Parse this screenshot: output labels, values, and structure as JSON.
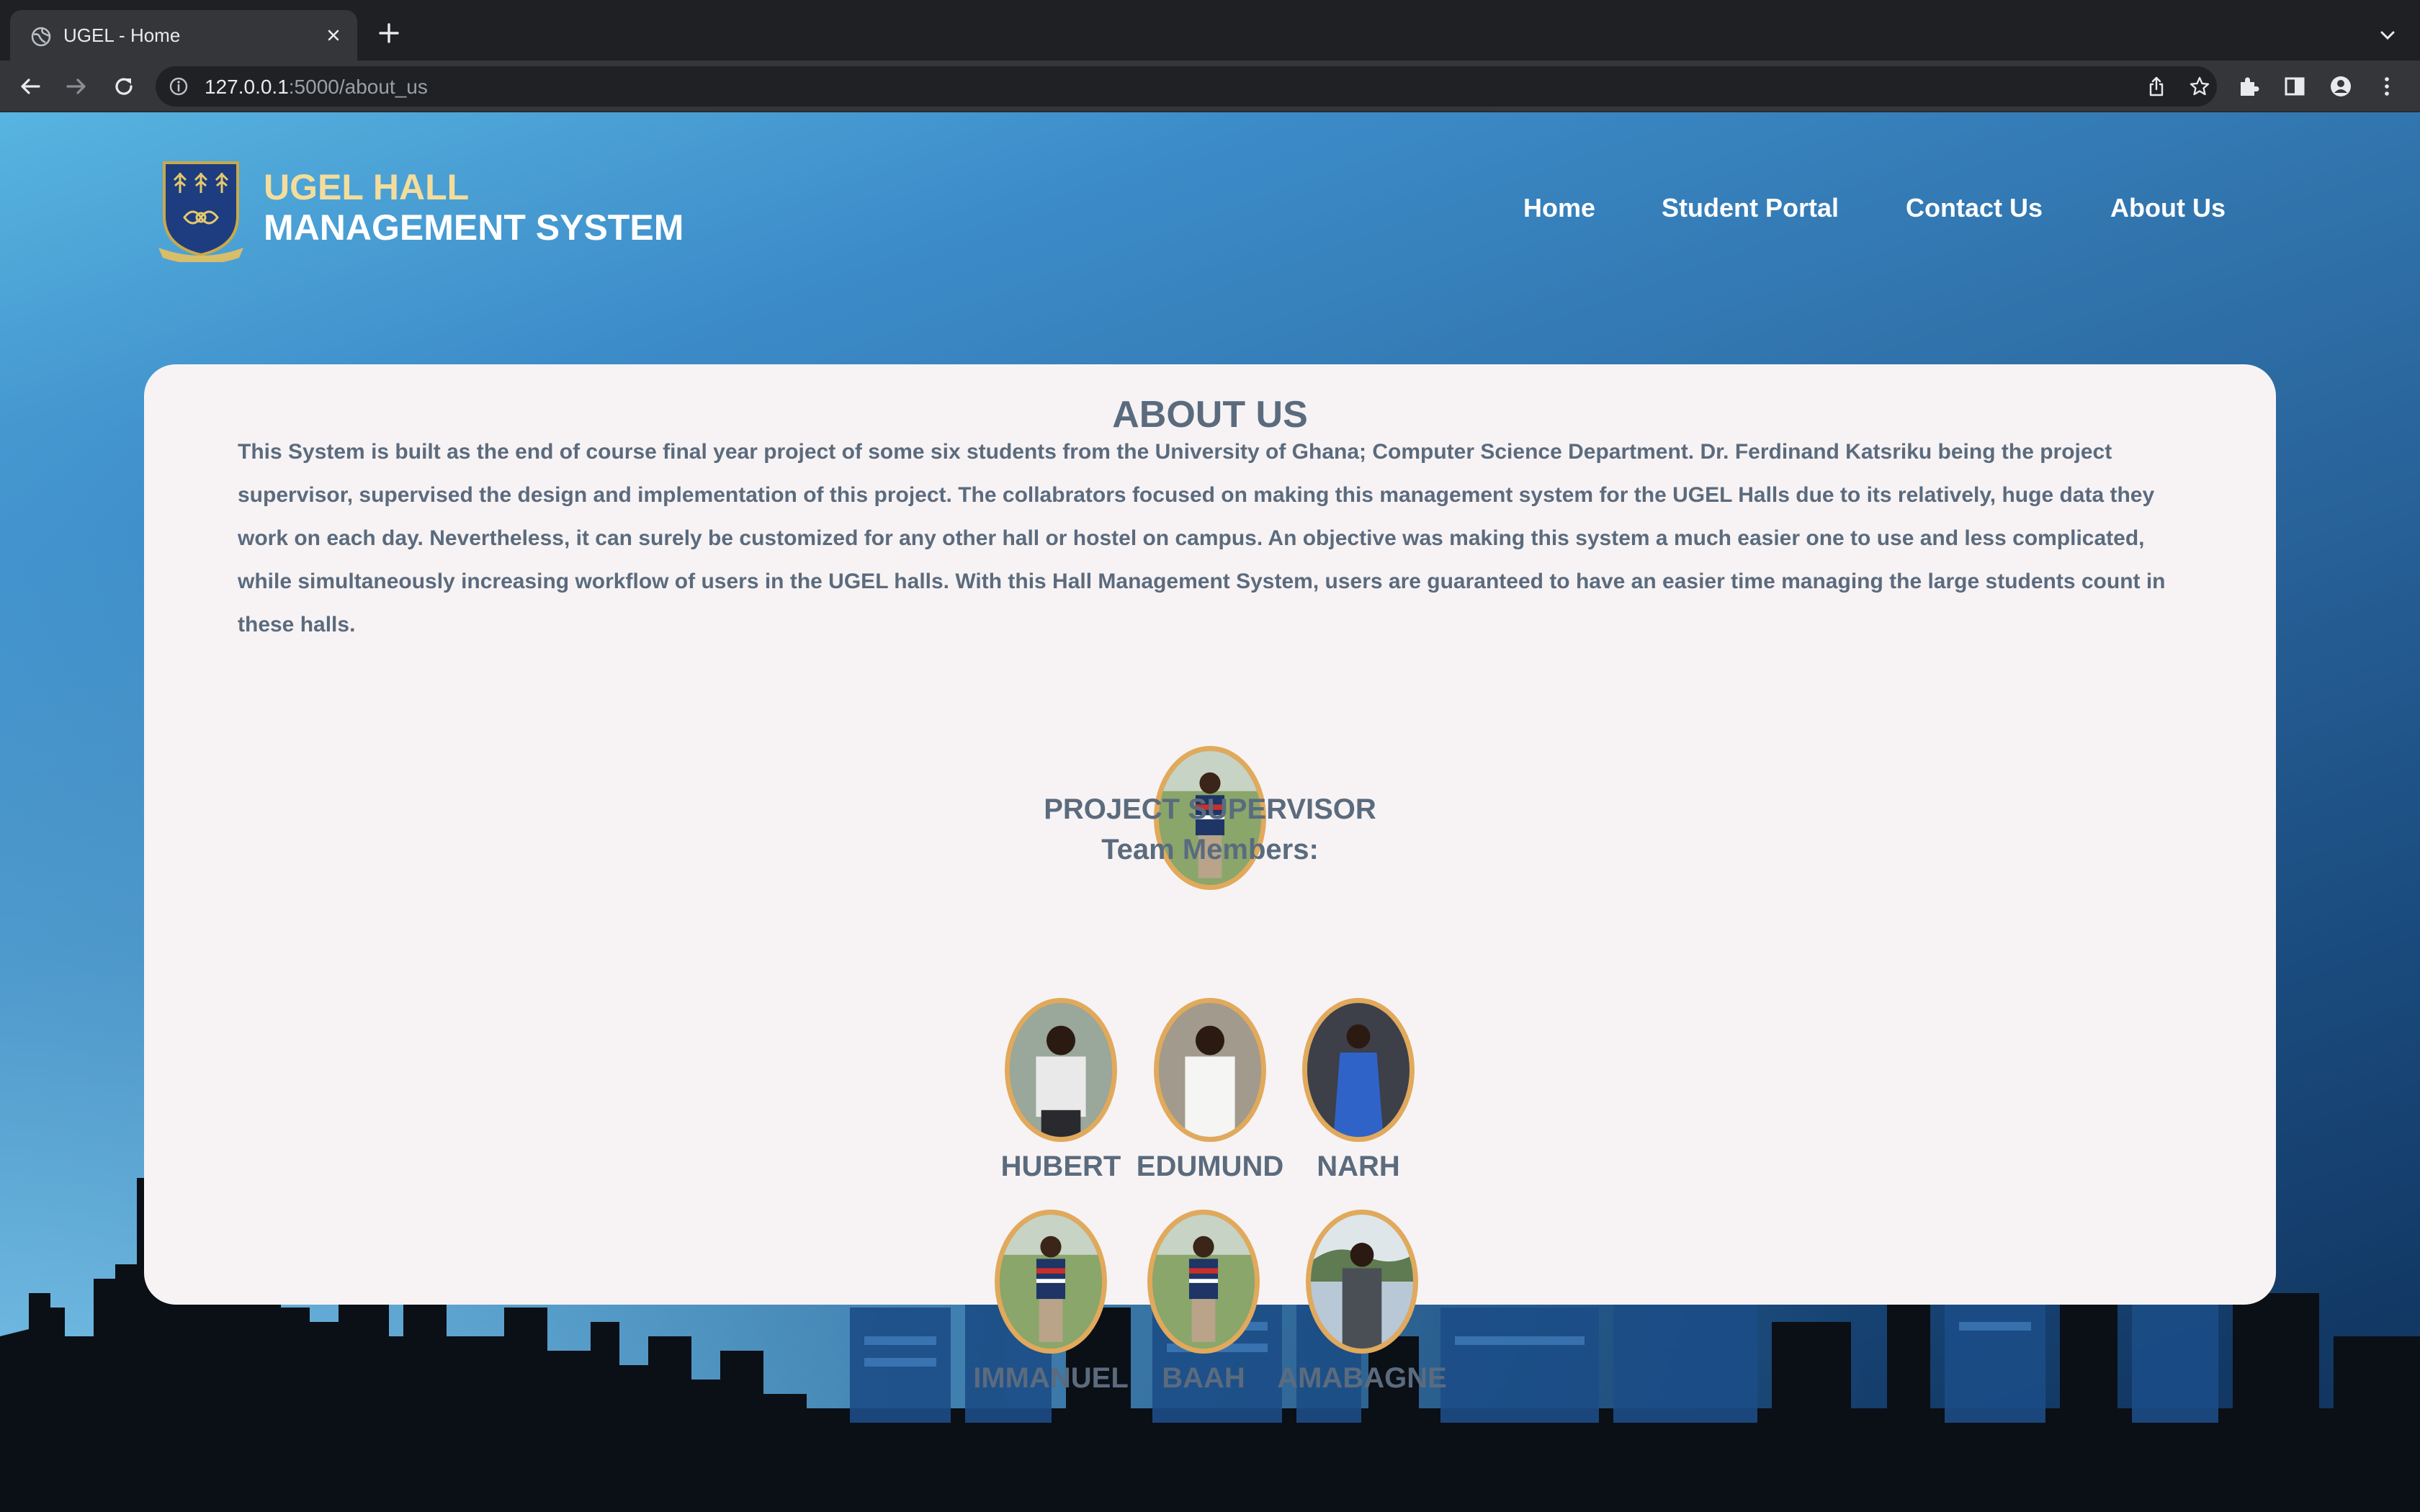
{
  "browser": {
    "tab_title": "UGEL - Home",
    "url_host": "127.0.0.1",
    "url_rest": ":5000/about_us"
  },
  "header": {
    "brand_line1": "UGEL HALL",
    "brand_line2": "MANAGEMENT SYSTEM",
    "nav": [
      "Home",
      "Student Portal",
      "Contact Us",
      "About Us"
    ]
  },
  "about": {
    "title": "ABOUT US",
    "text": "This System is built as the end of course final year project of some six students from the University of Ghana; Computer Science Department. Dr. Ferdinand Katsriku being the project supervisor, supervised the design and implementation of this project. The collabrators focused on making this management system for the UGEL Halls due to its relatively, huge data they work on each day. Nevertheless, it can surely be customized for any other hall or hostel on campus. An objective was making this system a much easier one to use and less complicated, while simultaneously increasing workflow of users in the UGEL halls. With this Hall Management System, users are guaranteed to have an easier time managing the large students count in these halls.",
    "supervisor_label": "PROJECT SUPERVISOR",
    "team_heading": "Team Members:",
    "members": [
      "HUBERT",
      "EDUMUND",
      "NARH",
      "IMMANUEL",
      "BAAH",
      "AMABAGNE"
    ]
  },
  "colors": {
    "brand_gold": "#f4dd9c",
    "text_slate": "#5b6b7e",
    "photo_border": "#e1a95c",
    "card_bg": "#f7f3f4"
  }
}
